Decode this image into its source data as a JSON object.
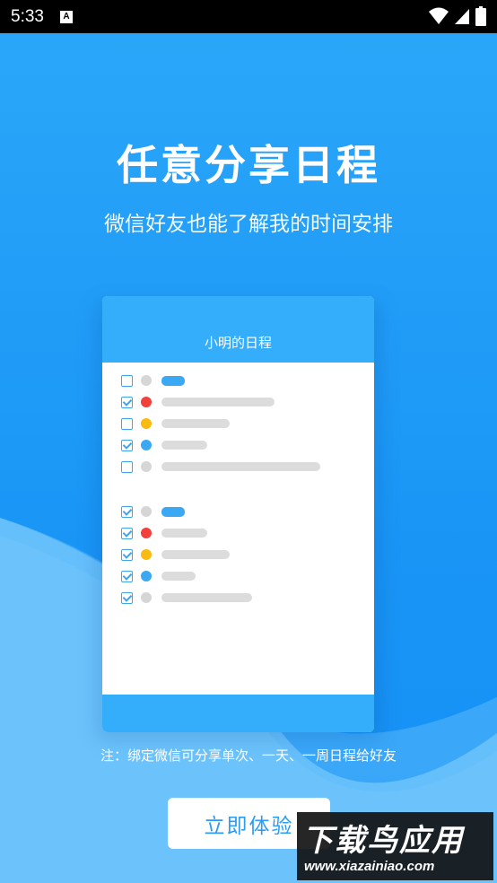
{
  "status_bar": {
    "time": "5:33",
    "indicator": "A"
  },
  "headline": "任意分享日程",
  "subline": "微信好友也能了解我的时间安排",
  "card": {
    "title": "小明的日程",
    "tasks": [
      {
        "checked": false,
        "dot": "#d6d6d6",
        "bar": "accent"
      },
      {
        "checked": true,
        "dot": "#f2403a",
        "bar": "gray"
      },
      {
        "checked": false,
        "dot": "#f9bb10",
        "bar": "gray"
      },
      {
        "checked": true,
        "dot": "#3aa8f3",
        "bar": "gray"
      },
      {
        "checked": false,
        "dot": "#d6d6d6",
        "bar": "gray"
      },
      {
        "checked": true,
        "dot": "#d6d6d6",
        "bar": "accent"
      },
      {
        "checked": true,
        "dot": "#f2403a",
        "bar": "gray"
      },
      {
        "checked": true,
        "dot": "#f9bb10",
        "bar": "gray"
      },
      {
        "checked": true,
        "dot": "#3aa8f3",
        "bar": "gray"
      },
      {
        "checked": true,
        "dot": "#d6d6d6",
        "bar": "gray"
      }
    ]
  },
  "note": "注：绑定微信可分享单次、一天、一周日程给好友",
  "cta_label": "立即体验",
  "watermark": {
    "title": "下载鸟应用",
    "url": "www.xiazainiao.com"
  },
  "colors": {
    "primary": "#1a9bf7",
    "card_header": "#34adfa",
    "checkbox": "#3fa5ee"
  }
}
